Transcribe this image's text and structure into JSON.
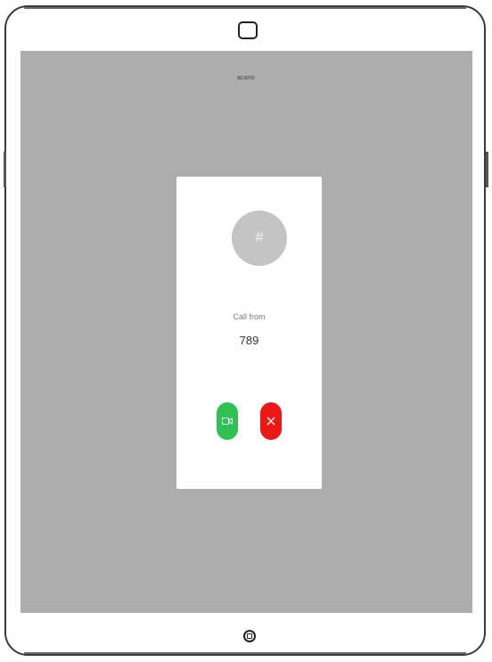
{
  "status": {
    "label": "acano"
  },
  "incoming_call": {
    "avatar_initial": "#",
    "label": "Call from",
    "caller_number": "789"
  },
  "actions": {
    "accept_icon": "video-camera-icon",
    "decline_icon": "close-icon"
  },
  "colors": {
    "screen_bg": "#adadad",
    "accept": "#2fc154",
    "decline": "#ef1616"
  }
}
